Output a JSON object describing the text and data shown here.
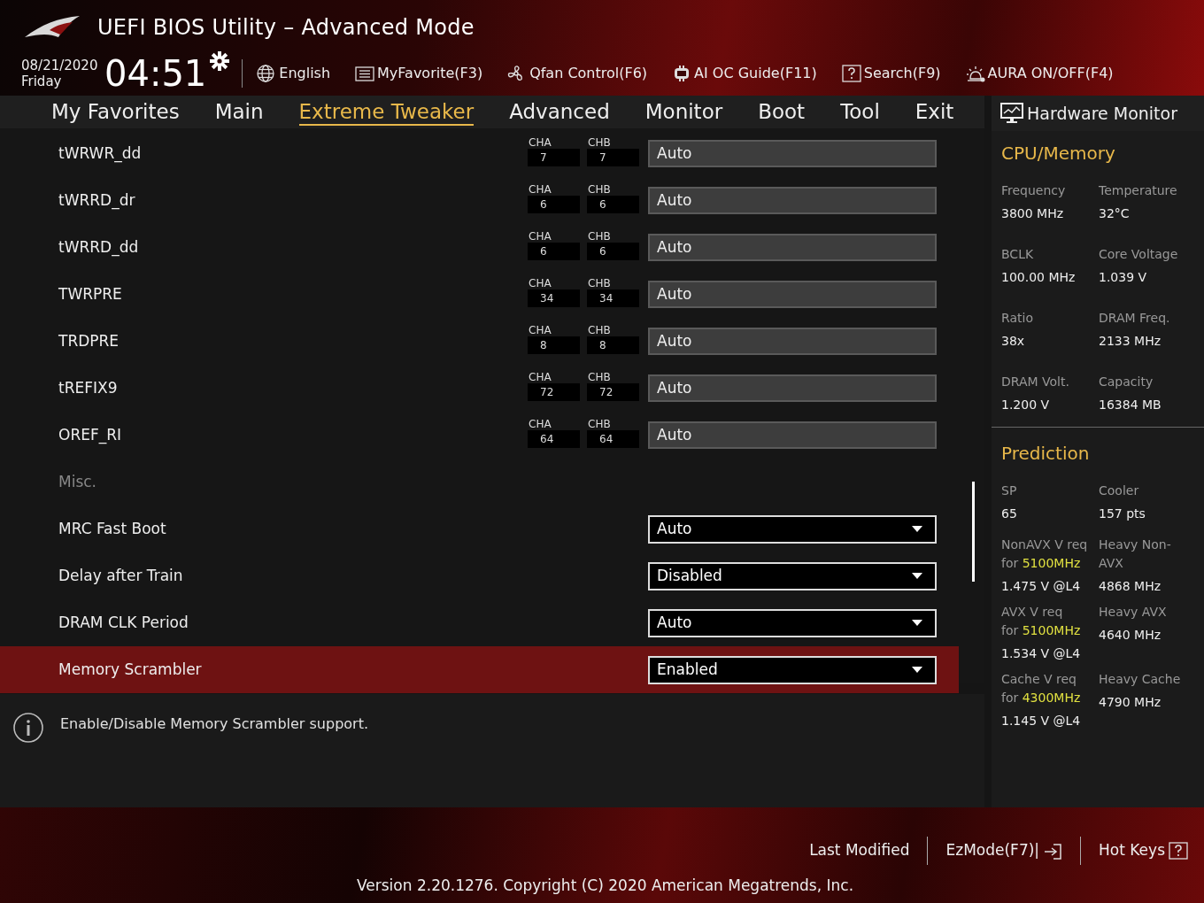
{
  "header": {
    "title": "UEFI BIOS Utility – Advanced Mode",
    "date": "08/21/2020",
    "day": "Friday",
    "time": "04:51",
    "tools": [
      {
        "kind": "globe",
        "label": "English"
      },
      {
        "kind": "list",
        "label": "MyFavorite(F3)"
      },
      {
        "kind": "fan",
        "label": "Qfan Control(F6)"
      },
      {
        "kind": "chip",
        "label": "AI OC Guide(F11)"
      },
      {
        "kind": "question",
        "label": "Search(F9)"
      },
      {
        "kind": "light",
        "label": "AURA ON/OFF(F4)"
      }
    ]
  },
  "tabs": [
    {
      "label": "My Favorites",
      "selected": false
    },
    {
      "label": "Main",
      "selected": false
    },
    {
      "label": "Extreme Tweaker",
      "selected": true
    },
    {
      "label": "Advanced",
      "selected": false
    },
    {
      "label": "Monitor",
      "selected": false
    },
    {
      "label": "Boot",
      "selected": false
    },
    {
      "label": "Tool",
      "selected": false
    },
    {
      "label": "Exit",
      "selected": false
    }
  ],
  "items": [
    {
      "kind": "timing",
      "label": "tWRWR_dd",
      "cha_label": "CHA",
      "cha": "7",
      "chb_label": "CHB",
      "chb": "7",
      "value": "Auto",
      "selected": false
    },
    {
      "kind": "timing",
      "label": "tWRRD_dr",
      "cha_label": "CHA",
      "cha": "6",
      "chb_label": "CHB",
      "chb": "6",
      "value": "Auto",
      "selected": false
    },
    {
      "kind": "timing",
      "label": "tWRRD_dd",
      "cha_label": "CHA",
      "cha": "6",
      "chb_label": "CHB",
      "chb": "6",
      "value": "Auto",
      "selected": false
    },
    {
      "kind": "timing",
      "label": "TWRPRE",
      "cha_label": "CHA",
      "cha": "34",
      "chb_label": "CHB",
      "chb": "34",
      "value": "Auto",
      "selected": false
    },
    {
      "kind": "timing",
      "label": "TRDPRE",
      "cha_label": "CHA",
      "cha": "8",
      "chb_label": "CHB",
      "chb": "8",
      "value": "Auto",
      "selected": false
    },
    {
      "kind": "timing",
      "label": "tREFIX9",
      "cha_label": "CHA",
      "cha": "72",
      "chb_label": "CHB",
      "chb": "72",
      "value": "Auto",
      "selected": false
    },
    {
      "kind": "timing",
      "label": "OREF_RI",
      "cha_label": "CHA",
      "cha": "64",
      "chb_label": "CHB",
      "chb": "64",
      "value": "Auto",
      "selected": false
    },
    {
      "kind": "section",
      "label": "Misc.",
      "selected": false
    },
    {
      "kind": "dropdown",
      "label": "MRC Fast Boot",
      "value": "Auto",
      "selected": false
    },
    {
      "kind": "dropdown",
      "label": "Delay after Train",
      "value": "Disabled",
      "selected": false
    },
    {
      "kind": "dropdown",
      "label": "DRAM CLK Period",
      "value": "Auto",
      "selected": false
    },
    {
      "kind": "dropdown",
      "label": "Memory Scrambler",
      "value": "Enabled",
      "selected": true
    }
  ],
  "help": "Enable/Disable Memory Scrambler support.",
  "monitor": {
    "title": "Hardware Monitor",
    "sections": [
      {
        "title": "CPU/Memory",
        "pairs": [
          {
            "label": "Frequency",
            "value": "3800 MHz"
          },
          {
            "label": "Temperature",
            "value": "32°C"
          },
          {
            "label": "BCLK",
            "value": "100.00 MHz"
          },
          {
            "label": "Core Voltage",
            "value": "1.039 V"
          },
          {
            "label": "Ratio",
            "value": "38x"
          },
          {
            "label": "DRAM Freq.",
            "value": "2133 MHz"
          },
          {
            "label": "DRAM Volt.",
            "value": "1.200 V"
          },
          {
            "label": "Capacity",
            "value": "16384 MB"
          }
        ]
      },
      {
        "title": "Prediction",
        "pairs": [
          {
            "label": "SP",
            "value": "65"
          },
          {
            "label": "Cooler",
            "value": "157 pts"
          }
        ],
        "predictions": [
          {
            "label": "NonAVX V req",
            "freq_prefix": "for",
            "freq": "5100MHz",
            "voltage": "1.475 V @L4",
            "heavy_label": "Heavy Non-AVX",
            "heavy_value": "4868 MHz"
          },
          {
            "label": "AVX V req",
            "freq_prefix": "for",
            "freq": "5100MHz",
            "voltage": "1.534 V @L4",
            "heavy_label": "Heavy AVX",
            "heavy_value": "4640 MHz"
          },
          {
            "label": "Cache V req",
            "freq_prefix": "for",
            "freq": "4300MHz",
            "voltage": "1.145 V @L4",
            "heavy_label": "Heavy Cache",
            "heavy_value": "4790 MHz"
          }
        ]
      }
    ]
  },
  "footer": {
    "buttons": [
      {
        "kind": "plain",
        "label": "Last Modified"
      },
      {
        "kind": "exit",
        "label": "EzMode(F7)|"
      },
      {
        "kind": "question",
        "label": "Hot Keys"
      }
    ],
    "version": "Version 2.20.1276. Copyright (C) 2020 American Megatrends, Inc."
  }
}
